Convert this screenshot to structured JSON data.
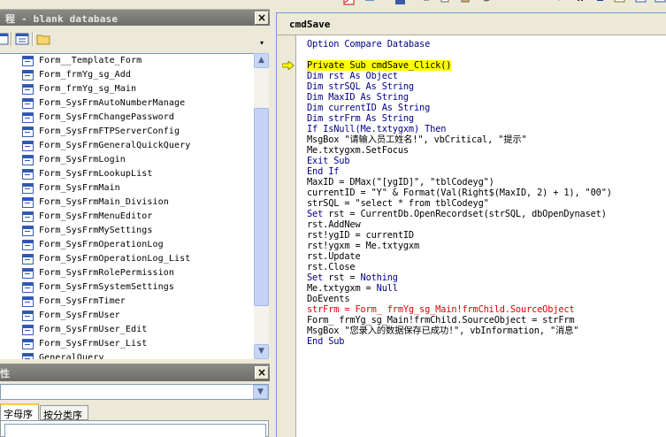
{
  "project_explorer": {
    "title": "程 - blank database",
    "close_label": "×",
    "items": [
      {
        "label": "Form__Template_Form"
      },
      {
        "label": "Form_frmYg_sg_Add"
      },
      {
        "label": "Form_frmYg_sg_Main"
      },
      {
        "label": "Form_SysFrmAutoNumberManage"
      },
      {
        "label": "Form_SysFrmChangePassword"
      },
      {
        "label": "Form_SysFrmFTPServerConfig"
      },
      {
        "label": "Form_SysFrmGeneralQuickQuery"
      },
      {
        "label": "Form_SysFrmLogin"
      },
      {
        "label": "Form_SysFrmLookupList"
      },
      {
        "label": "Form_SysFrmMain"
      },
      {
        "label": "Form_SysFrmMain_Division"
      },
      {
        "label": "Form_SysFrmMenuEditor"
      },
      {
        "label": "Form_SysFrmMySettings"
      },
      {
        "label": "Form_SysFrmOperationLog"
      },
      {
        "label": "Form_SysFrmOperationLog_List"
      },
      {
        "label": "Form_SysFrmRolePermission"
      },
      {
        "label": "Form_SysFrmSystemSettings"
      },
      {
        "label": "Form_SysFrmTimer"
      },
      {
        "label": "Form_SysFrmUser"
      },
      {
        "label": "Form_SysFrmUser_Edit"
      },
      {
        "label": "Form_SysFrmUser_List"
      },
      {
        "label": "GeneralQuery"
      }
    ]
  },
  "properties": {
    "title": "性",
    "close_label": "×",
    "tabs": [
      {
        "label": "字母序"
      },
      {
        "label": "按分类序"
      }
    ]
  },
  "code_window": {
    "procedure": "cmdSave",
    "lines": [
      [
        {
          "t": "Option Compare Database",
          "c": "kw"
        }
      ],
      [],
      [
        {
          "t": "Private Sub cmdSave_Click()",
          "c": "exec"
        }
      ],
      [
        {
          "t": "Dim rst As Object",
          "c": "kw"
        }
      ],
      [
        {
          "t": "Dim strSQL As String",
          "c": "kw"
        }
      ],
      [
        {
          "t": "Dim MaxID As String",
          "c": "kw"
        }
      ],
      [
        {
          "t": "Dim currentID As String",
          "c": "kw"
        }
      ],
      [
        {
          "t": "Dim strFrm As String",
          "c": "kw"
        }
      ],
      [
        {
          "t": "If IsNull(Me.txtygxm) Then",
          "c": "kw"
        }
      ],
      [
        {
          "t": "MsgBox \"请输入员工姓名!\", vbCritical, \"提示\"",
          "c": "tx"
        }
      ],
      [
        {
          "t": "Me.txtygxm.SetFocus",
          "c": "tx"
        }
      ],
      [
        {
          "t": "Exit Sub",
          "c": "kw"
        }
      ],
      [
        {
          "t": "End If",
          "c": "kw"
        }
      ],
      [
        {
          "t": "MaxID = DMax(\"[ygID]\", \"tblCodeyg\")",
          "c": "tx"
        }
      ],
      [
        {
          "t": "currentID = \"Y\" & Format(Val(Right$(MaxID, 2) + 1), \"00\")",
          "c": "tx"
        }
      ],
      [
        {
          "t": "strSQL = \"select * from tblCodeyg\"",
          "c": "tx"
        }
      ],
      [
        {
          "t": "Set",
          "c": "kw"
        },
        {
          "t": " rst = CurrentDb.OpenRecordset(strSQL, dbOpenDynaset)",
          "c": "tx"
        }
      ],
      [
        {
          "t": "rst.AddNew",
          "c": "tx"
        }
      ],
      [
        {
          "t": "rst!ygID = currentID",
          "c": "tx"
        }
      ],
      [
        {
          "t": "rst!ygxm = Me.txtygxm",
          "c": "tx"
        }
      ],
      [
        {
          "t": "rst.Update",
          "c": "tx"
        }
      ],
      [
        {
          "t": "rst.Close",
          "c": "tx"
        }
      ],
      [
        {
          "t": "Set",
          "c": "kw"
        },
        {
          "t": " rst = ",
          "c": "tx"
        },
        {
          "t": "Nothing",
          "c": "kw"
        }
      ],
      [
        {
          "t": "Me.txtygxm = ",
          "c": "tx"
        },
        {
          "t": "Null",
          "c": "kw"
        }
      ],
      [
        {
          "t": "DoEvents",
          "c": "tx"
        }
      ],
      [
        {
          "t": "strFrm = Form_ frmYg_sg_Main!frmChild.SourceObject",
          "c": "err"
        }
      ],
      [
        {
          "t": "Form_ frmYg_sg_Main!frmChild.SourceObject = strFrm",
          "c": "tx"
        }
      ],
      [
        {
          "t": "MsgBox \"您录入的数据保存已成功!\", vbInformation, \"消息\"",
          "c": "tx"
        }
      ],
      [
        {
          "t": "End Sub",
          "c": "kw"
        }
      ]
    ]
  }
}
